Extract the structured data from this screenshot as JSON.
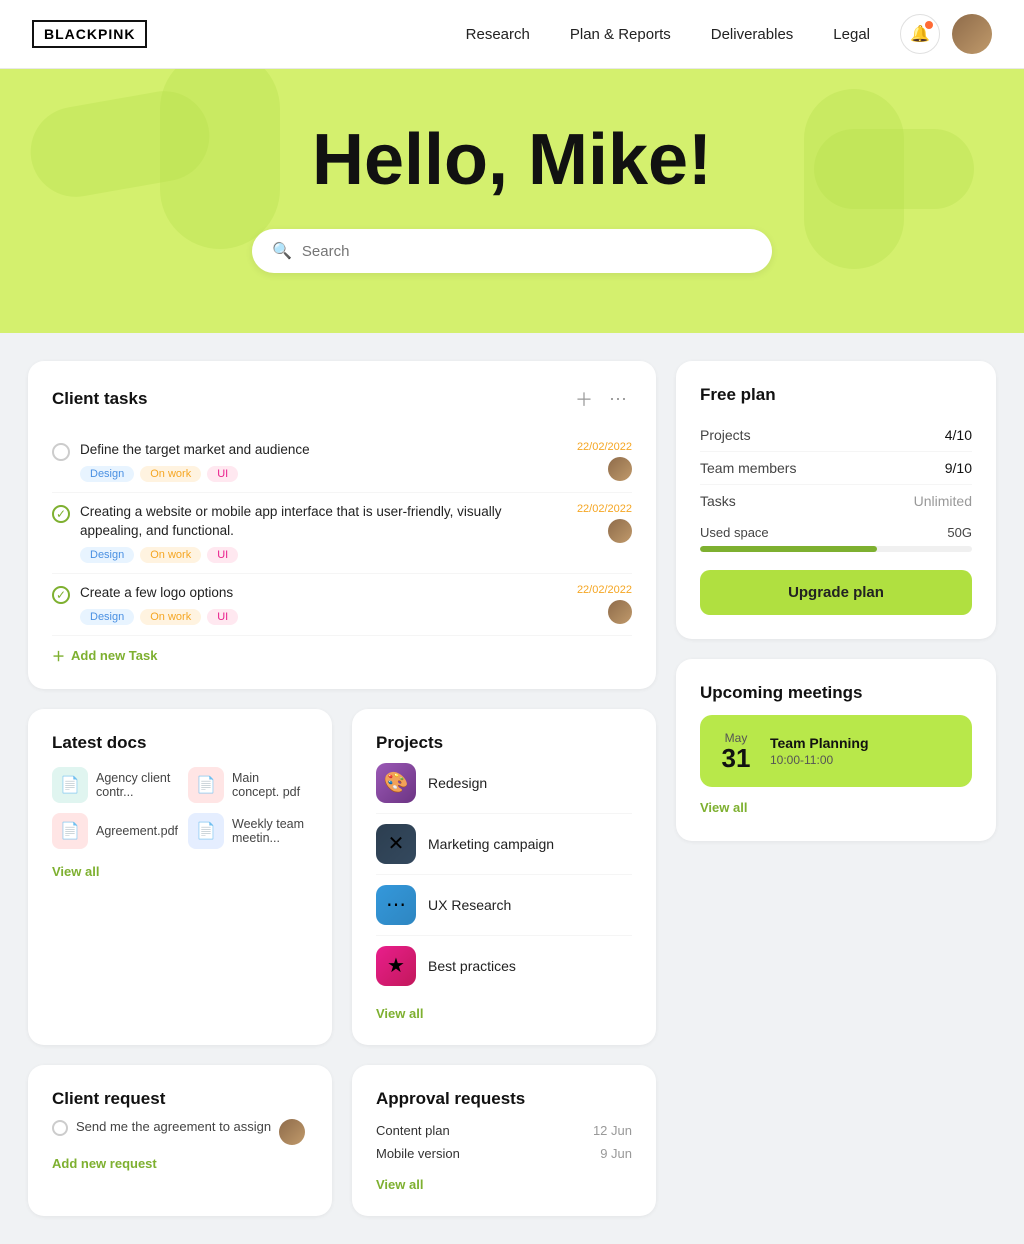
{
  "logo": "BLACKPINK",
  "nav": {
    "links": [
      "Research",
      "Plan & Reports",
      "Deliverables",
      "Legal"
    ]
  },
  "hero": {
    "greeting": "Hello, Mike!",
    "search_placeholder": "Search"
  },
  "client_tasks": {
    "title": "Client tasks",
    "tasks": [
      {
        "text": "Define the target market and audience",
        "done": false,
        "tags": [
          "Design",
          "On work",
          "UI"
        ],
        "date": "22/02/2022"
      },
      {
        "text": "Creating a website or mobile app interface that is user-friendly, visually appealing, and functional.",
        "done": true,
        "tags": [
          "Design",
          "On work",
          "UI"
        ],
        "date": "22/02/2022"
      },
      {
        "text": "Create a few logo options",
        "done": true,
        "tags": [
          "Design",
          "On work",
          "UI"
        ],
        "date": "22/02/2022"
      }
    ],
    "add_task_label": "Add new Task"
  },
  "latest_docs": {
    "title": "Latest docs",
    "docs": [
      {
        "name": "Agency client contr...",
        "type": "teal"
      },
      {
        "name": "Main concept. pdf",
        "type": "red"
      },
      {
        "name": "Agreement.pdf",
        "type": "red"
      },
      {
        "name": "Weekly team meetin...",
        "type": "blue"
      }
    ],
    "view_all": "View all"
  },
  "projects": {
    "title": "Projects",
    "items": [
      {
        "name": "Redesign",
        "color": "purple"
      },
      {
        "name": "Marketing campaign",
        "color": "dark"
      },
      {
        "name": "UX Research",
        "color": "blue"
      },
      {
        "name": "Best practices",
        "color": "pink"
      }
    ],
    "view_all": "View all"
  },
  "free_plan": {
    "title": "Free plan",
    "rows": [
      {
        "label": "Projects",
        "value": "4/10"
      },
      {
        "label": "Team members",
        "value": "9/10"
      },
      {
        "label": "Tasks",
        "value": "Unlimited"
      }
    ],
    "used_space_label": "Used space",
    "used_space_value": "50G",
    "progress_percent": 65,
    "upgrade_label": "Upgrade plan"
  },
  "upcoming_meetings": {
    "title": "Upcoming meetings",
    "meeting": {
      "month": "May",
      "day": "31",
      "title": "Team Planning",
      "time": "10:00-11:00"
    },
    "view_all": "View all"
  },
  "client_request": {
    "title": "Client request",
    "task": "Send me the agreement to assign",
    "add_label": "Add new request"
  },
  "approval_requests": {
    "title": "Approval requests",
    "items": [
      {
        "name": "Content plan",
        "date": "12 Jun"
      },
      {
        "name": "Mobile version",
        "date": "9 Jun"
      }
    ],
    "view_all": "View all"
  }
}
